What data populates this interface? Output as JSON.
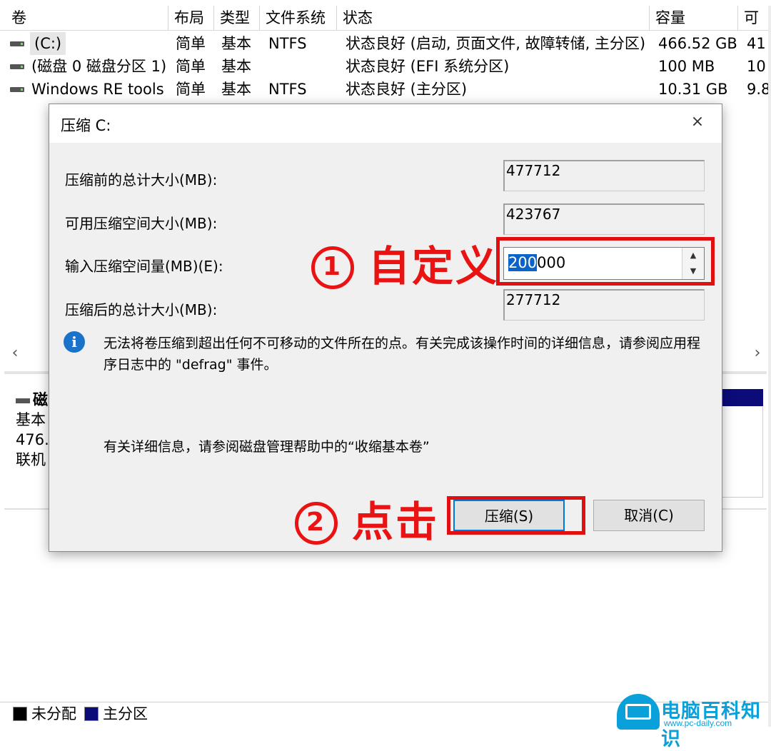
{
  "volume_list": {
    "columns": [
      "卷",
      "布局",
      "类型",
      "文件系统",
      "状态",
      "容量",
      "可"
    ],
    "rows": [
      {
        "name": "(C:)",
        "layout": "简单",
        "type": "基本",
        "fs": "NTFS",
        "status": "状态良好 (启动, 页面文件, 故障转储, 主分区)",
        "capacity": "466.52 GB",
        "free": "41"
      },
      {
        "name": "(磁盘 0 磁盘分区 1)",
        "layout": "简单",
        "type": "基本",
        "fs": "",
        "status": "状态良好 (EFI 系统分区)",
        "capacity": "100 MB",
        "free": "10"
      },
      {
        "name": "Windows RE tools",
        "layout": "简单",
        "type": "基本",
        "fs": "NTFS",
        "status": "状态良好 (主分区)",
        "capacity": "10.31 GB",
        "free": "9.8"
      }
    ]
  },
  "scroll": {
    "left_arrow": "‹",
    "right_arrow": "›"
  },
  "disk_panel": {
    "name": "磁",
    "type": "基本",
    "size": "476.",
    "status": "联机"
  },
  "legend": {
    "unallocated": "未分配",
    "primary": "主分区",
    "unallocated_color": "#000000",
    "primary_color": "#0b0b7a"
  },
  "dialog": {
    "title": "压缩 C:",
    "close": "×",
    "fields": {
      "total_before_label": "压缩前的总计大小(MB):",
      "total_before_value": "477712",
      "available_label": "可用压缩空间大小(MB):",
      "available_value": "423767",
      "input_label": "输入压缩空间量(MB)(E):",
      "input_value_selected": "200",
      "input_value_rest": "000",
      "total_after_label": "压缩后的总计大小(MB):",
      "total_after_value": "277712"
    },
    "info_icon": "i",
    "info_text": "无法将卷压缩到超出任何不可移动的文件所在的点。有关完成该操作时间的详细信息，请参阅应用程序日志中的 \"defrag\" 事件。",
    "help_text": "有关详细信息，请参阅磁盘管理帮助中的“收缩基本卷”",
    "shrink_button": "压缩(S)",
    "cancel_button": "取消(C)"
  },
  "annotations": {
    "step1_num": "1",
    "step1_text": "自定义",
    "step2_num": "2",
    "step2_text": "点击",
    "color": "#ea1313"
  },
  "watermark": {
    "title": "电脑百科知识",
    "url": "www.pc-daily.com"
  }
}
